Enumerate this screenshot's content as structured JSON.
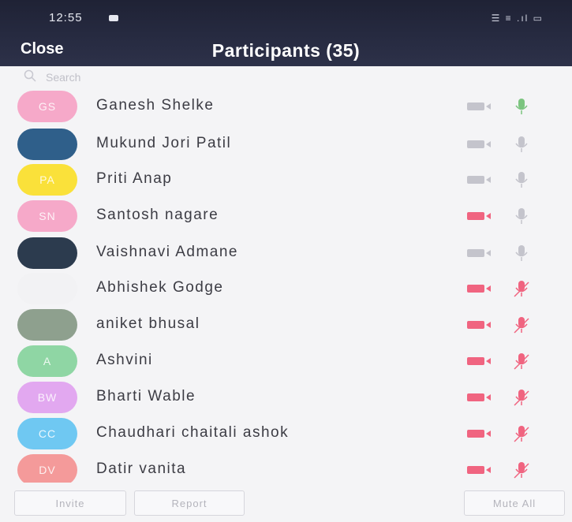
{
  "status_bar": {
    "time": "12:55",
    "indicators": "☰ ≡ .ıl ▭"
  },
  "header": {
    "close_label": "Close",
    "title": "Participants (35)"
  },
  "search": {
    "placeholder": "Search",
    "icon": "search-icon"
  },
  "participants": [
    {
      "name": "Ganesh Shelke",
      "avatar_initials": "GS",
      "avatar_color": "#f6a9c9",
      "video": "on",
      "audio": "unmuted-speaking"
    },
    {
      "name": "Mukund Jori Patil",
      "avatar_initials": "",
      "avatar_color": "#2f5f8a",
      "video": "on",
      "audio": "unmuted"
    },
    {
      "name": "Priti Anap",
      "avatar_initials": "PA",
      "avatar_color": "#fae13a",
      "video": "on",
      "audio": "unmuted"
    },
    {
      "name": "Santosh nagare",
      "avatar_initials": "SN",
      "avatar_color": "#f6a9c9",
      "video": "off",
      "audio": "unmuted"
    },
    {
      "name": "Vaishnavi Admane",
      "avatar_initials": "",
      "avatar_color": "#2c3b4e",
      "video": "on",
      "audio": "unmuted"
    },
    {
      "name": "Abhishek Godge",
      "avatar_initials": "",
      "avatar_color": "#f2f2f4",
      "video": "off",
      "audio": "muted"
    },
    {
      "name": "aniket bhusal",
      "avatar_initials": "",
      "avatar_color": "#8ea08e",
      "video": "off",
      "audio": "muted"
    },
    {
      "name": "Ashvini",
      "avatar_initials": "A",
      "avatar_color": "#8fd6a4",
      "video": "off",
      "audio": "muted"
    },
    {
      "name": "Bharti Wable",
      "avatar_initials": "BW",
      "avatar_color": "#e2a8f0",
      "video": "off",
      "audio": "muted"
    },
    {
      "name": "Chaudhari chaitali ashok",
      "avatar_initials": "CC",
      "avatar_color": "#6fc8f2",
      "video": "off",
      "audio": "muted"
    },
    {
      "name": "Datir vanita",
      "avatar_initials": "DV",
      "avatar_color": "#f49a9a",
      "video": "off",
      "audio": "muted"
    }
  ],
  "footer": {
    "invite_label": "Invite",
    "report_label": "Report",
    "mute_all_label": "Mute All"
  },
  "colors": {
    "header_bg": "#262a40",
    "muted_red": "#f06480",
    "icon_gray": "#c4c4cc",
    "speaking_green": "#7bc47f"
  }
}
